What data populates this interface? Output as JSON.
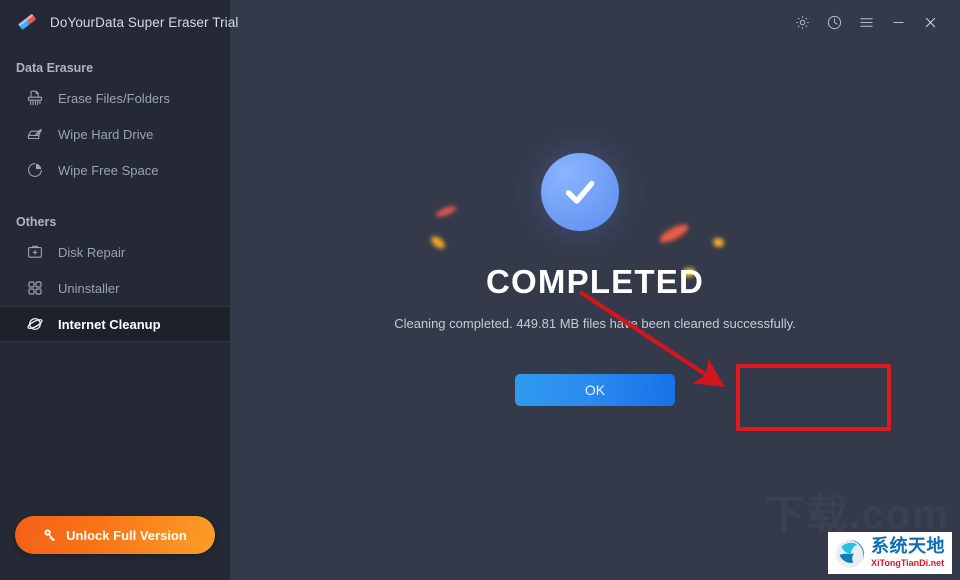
{
  "app": {
    "title": "DoYourData Super Eraser Trial",
    "logo_icon": "eraser-icon"
  },
  "titlebar": {
    "tools": [
      {
        "name": "settings-icon",
        "label": "Settings"
      },
      {
        "name": "history-icon",
        "label": "History"
      },
      {
        "name": "menu-icon",
        "label": "Menu"
      },
      {
        "name": "minimize-icon",
        "label": "Minimize"
      },
      {
        "name": "close-icon",
        "label": "Close"
      }
    ]
  },
  "sidebar": {
    "sections": [
      {
        "label": "Data Erasure",
        "items": [
          {
            "label": "Erase Files/Folders",
            "icon": "shredder-icon",
            "active": false
          },
          {
            "label": "Wipe Hard Drive",
            "icon": "harddrive-pencil-icon",
            "active": false
          },
          {
            "label": "Wipe Free Space",
            "icon": "pie-chart-icon",
            "active": false
          }
        ]
      },
      {
        "label": "Others",
        "items": [
          {
            "label": "Disk Repair",
            "icon": "toolbox-icon",
            "active": false
          },
          {
            "label": "Uninstaller",
            "icon": "grid-squares-icon",
            "active": false
          },
          {
            "label": "Internet Cleanup",
            "icon": "planet-icon",
            "active": true
          }
        ]
      }
    ],
    "unlock_button": {
      "label": "Unlock Full Version",
      "icon": "key-icon",
      "color": "#f97316"
    }
  },
  "main": {
    "status_icon": "check-circle-icon",
    "heading": "COMPLETED",
    "status_text": "Cleaning completed. 449.81 MB files have been cleaned successfully.",
    "cleaned_size": "449.81 MB",
    "ok_button": {
      "label": "OK",
      "color": "#1f8bef"
    }
  },
  "annotations": {
    "highlight_rect_target": "ok-button",
    "arrow_target": "ok-button",
    "color": "#e01b1b"
  },
  "watermark": {
    "ghost_text": "下载.com",
    "logo_cn": "系统天地",
    "logo_en": "XiTongTianDi.net"
  },
  "colors": {
    "sidebar_bg": "#252936",
    "main_bg": "#353a4a",
    "active_item_bg": "#1d212c",
    "accent_blue": "#5b8bef",
    "accent_orange": "#f97316",
    "annotation_red": "#e01b1b"
  }
}
